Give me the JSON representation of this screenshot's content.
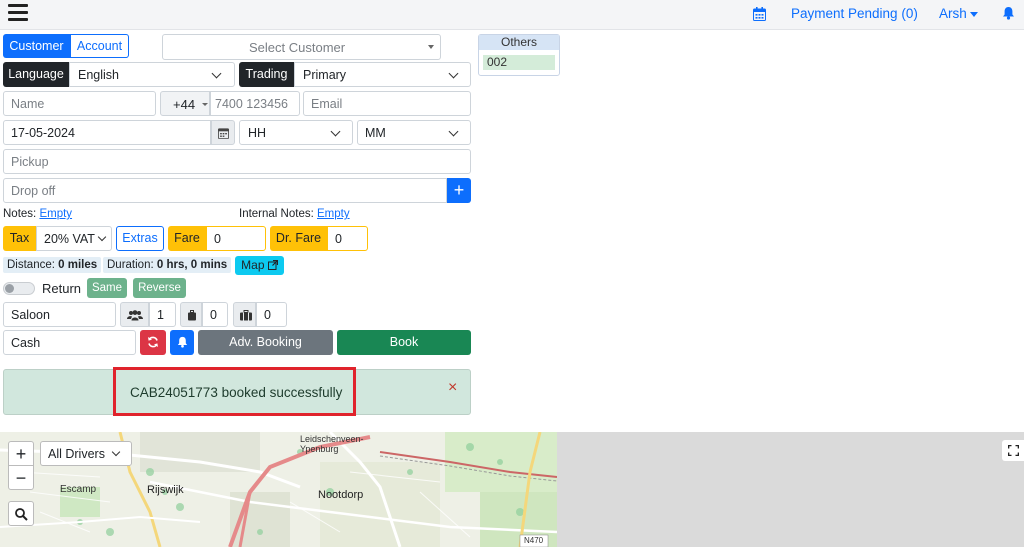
{
  "topbar": {
    "menu_icon": "hamburger-menu-icon",
    "calendar_icon": "calendar-icon",
    "payment_pending": "Payment Pending (0)",
    "user_name": "Arsh",
    "bell_icon": "bell-icon"
  },
  "tabs": {
    "customer": "Customer",
    "account": "Account"
  },
  "select_customer": {
    "placeholder": "Select Customer"
  },
  "language": {
    "label": "Language",
    "value": "English"
  },
  "trading": {
    "label": "Trading",
    "value": "Primary"
  },
  "contact": {
    "name_placeholder": "Name",
    "country_code": "+44",
    "phone_placeholder": "7400 123456",
    "email_placeholder": "Email"
  },
  "datetime": {
    "date": "17-05-2024",
    "hour": "HH",
    "minute": "MM"
  },
  "pickup": {
    "placeholder": "Pickup"
  },
  "dropoff": {
    "placeholder": "Drop off",
    "add_label": "+"
  },
  "notes": {
    "notes_label": "Notes:",
    "notes_value": "Empty",
    "internal_label": "Internal Notes:",
    "internal_value": "Empty"
  },
  "pricing": {
    "tax_label": "Tax",
    "tax_value": "20% VAT",
    "extras_label": "Extras",
    "fare_label": "Fare",
    "fare_value": "0",
    "dr_fare_label": "Dr. Fare",
    "dr_fare_value": "0"
  },
  "trip": {
    "distance_label": "Distance:",
    "distance_value": "0 miles",
    "duration_label": "Duration:",
    "duration_value": "0 hrs, 0 mins",
    "map_label": "Map"
  },
  "return": {
    "label": "Return",
    "same_label": "Same",
    "reverse_label": "Reverse"
  },
  "vehicle": {
    "type": "Saloon",
    "passengers": "1",
    "hand_luggage": "0",
    "luggage": "0"
  },
  "payment": {
    "method": "Cash",
    "adv_booking_label": "Adv. Booking",
    "book_label": "Book"
  },
  "alert": {
    "message": "CAB24051773 booked successfully",
    "close": "×"
  },
  "others": {
    "title": "Others",
    "items": [
      "002"
    ]
  },
  "map": {
    "zoom_in": "+",
    "zoom_out": "−",
    "drivers_filter": "All Drivers",
    "labels": [
      "Leidschenveen-Ypenburg",
      "Escamp",
      "Rijswijk",
      "Nootdorp",
      "N470"
    ],
    "fullscreen_icon": "fullscreen-icon"
  },
  "colors": {
    "primary": "#0d6efd",
    "dark": "#212529",
    "warning": "#ffc107",
    "success": "#198754",
    "danger": "#dc3545",
    "secondary": "#6c757d",
    "info": "#0dcaf0"
  }
}
